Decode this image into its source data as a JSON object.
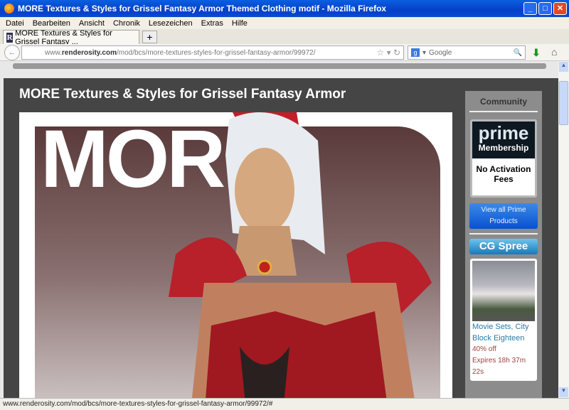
{
  "window": {
    "title": "MORE Textures & Styles for Grissel Fantasy Armor Themed Clothing motif - Mozilla Firefox"
  },
  "menu": [
    "Datei",
    "Bearbeiten",
    "Ansicht",
    "Chronik",
    "Lesezeichen",
    "Extras",
    "Hilfe"
  ],
  "tab": {
    "label": "MORE Textures & Styles for Grissel Fantasy ...",
    "new_tab": "+"
  },
  "address": {
    "prefix": "www.",
    "domain": "renderosity.com",
    "path": "/mod/bcs/more-textures-styles-for-grissel-fantasy-armor/99972/"
  },
  "search": {
    "placeholder": "Google"
  },
  "page": {
    "title": "MORE Textures & Styles for Grissel Fantasy Armor",
    "hero_text": "MORE"
  },
  "sidebar": {
    "heading": "Community",
    "prime": {
      "logo": "prime",
      "sub": "Membership",
      "tagline": "No Activation Fees"
    },
    "view_button": "View all Prime Products",
    "cg_spree": "CG Spree",
    "deal": {
      "title": "Movie Sets, City Block Eighteen",
      "discount": "40% off",
      "expires": "Expires 18h 37m 22s"
    }
  },
  "status": "www.renderosity.com/mod/bcs/more-textures-styles-for-grissel-fantasy-armor/99972/#"
}
